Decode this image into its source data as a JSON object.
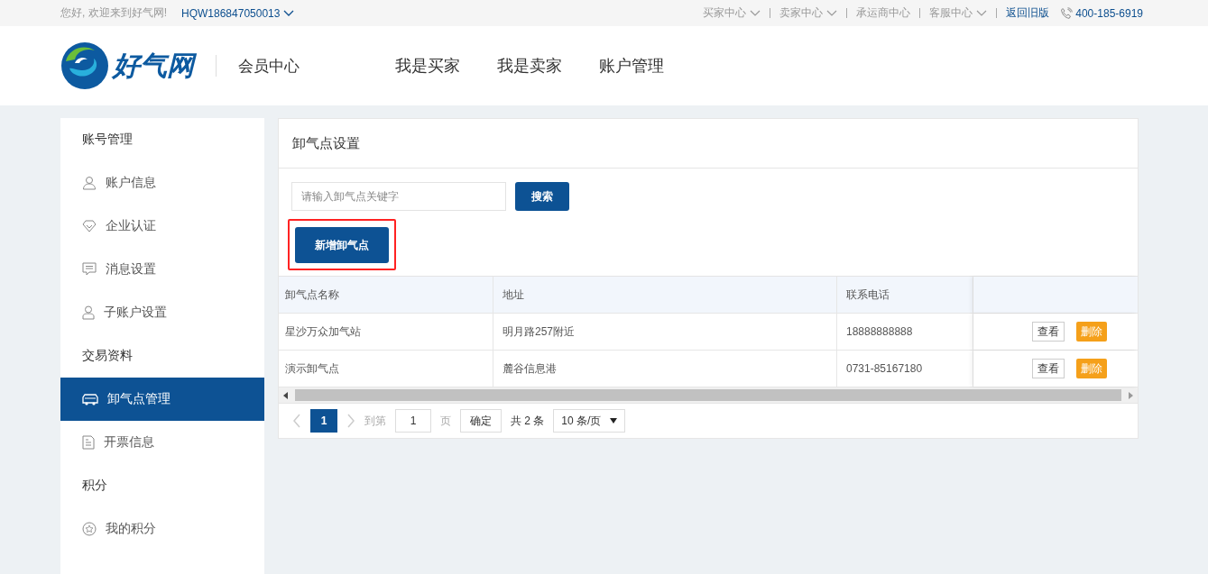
{
  "top_bar": {
    "greeting": "您好, 欢迎来到好气网!",
    "account": "HQW186847050013",
    "links": [
      {
        "label": "买家中心",
        "dropdown": true
      },
      {
        "label": "卖家中心",
        "dropdown": true
      },
      {
        "label": "承运商中心",
        "dropdown": false
      },
      {
        "label": "客服中心",
        "dropdown": true
      }
    ],
    "old_version": "返回旧版",
    "phone": "400-185-6919"
  },
  "header": {
    "logo_text": "好气网",
    "section": "会员中心",
    "nav": [
      {
        "label": "我是买家"
      },
      {
        "label": "我是卖家"
      },
      {
        "label": "账户管理"
      }
    ]
  },
  "sidebar": {
    "items": [
      {
        "kind": "heading",
        "label": "账号管理",
        "selected": false
      },
      {
        "kind": "item",
        "label": "账户信息",
        "selected": false
      },
      {
        "kind": "item",
        "label": "企业认证",
        "selected": false
      },
      {
        "kind": "item",
        "label": "消息设置",
        "selected": false
      },
      {
        "kind": "item",
        "label": "子账户设置",
        "selected": false
      },
      {
        "kind": "heading",
        "label": "交易资料",
        "selected": false
      },
      {
        "kind": "item",
        "label": "卸气点管理",
        "selected": true
      },
      {
        "kind": "item",
        "label": "开票信息",
        "selected": false
      },
      {
        "kind": "heading",
        "label": "积分",
        "selected": false
      },
      {
        "kind": "item",
        "label": "我的积分",
        "selected": false
      }
    ]
  },
  "panel": {
    "title": "卸气点设置",
    "search": {
      "placeholder": "请输入卸气点关键字",
      "button": "搜索"
    },
    "add_button": {
      "label": "新增卸气点",
      "highlighted": true
    },
    "table": {
      "columns": [
        "卸气点名称",
        "地址",
        "联系电话"
      ],
      "rows": [
        {
          "name": "星沙万众加气站",
          "address": "明月路257附近",
          "phone": "18888888888",
          "actions": [
            "查看",
            "删除"
          ]
        },
        {
          "name": "演示卸气点",
          "address": "麓谷信息港",
          "phone": "0731-85167180",
          "actions": [
            "查看",
            "删除"
          ]
        }
      ]
    },
    "pagination": {
      "pages": [
        {
          "label": "1",
          "selected": true
        }
      ],
      "goto_label": "到第",
      "goto_value": "1",
      "page_unit": "页",
      "confirm": "确定",
      "total": "共 2 条",
      "page_size": "10 条/页"
    }
  }
}
